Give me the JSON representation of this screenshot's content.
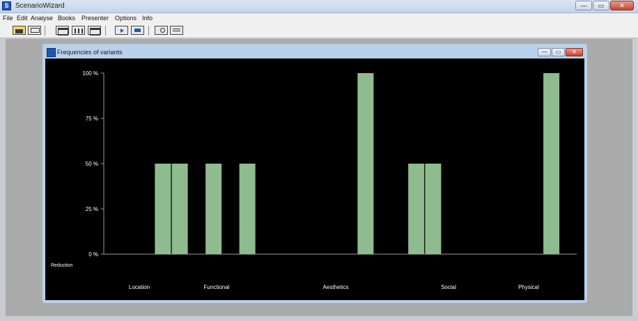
{
  "app": {
    "title": "ScenarioWizard",
    "menu": [
      "File",
      "Edit",
      "Analyse",
      "Books",
      "Presenter",
      "Options",
      "Info"
    ],
    "window_buttons": {
      "minimize": "—",
      "maximize": "▭",
      "close": "✕"
    }
  },
  "toolbar": {
    "buttons": [
      "open-icon",
      "save-icon",
      "table-icon",
      "columns-icon",
      "grid-icon",
      "play-icon",
      "text-icon",
      "search-icon",
      "list-icon"
    ]
  },
  "chart_window": {
    "title": "Frequencies of variants",
    "buttons": {
      "minimize": "—",
      "maximize": "▭",
      "close": "✕"
    }
  },
  "chart_data": {
    "type": "bar",
    "ylim": [
      0,
      100
    ],
    "yticks": [
      "0 %",
      "25 %",
      "50 %",
      "75 %",
      "100 %"
    ],
    "bar_color": "#8fbc8f",
    "background": "#000000",
    "values": [
      0,
      0,
      0,
      50,
      50,
      0,
      50,
      0,
      50,
      0,
      0,
      0,
      0,
      0,
      0,
      100,
      0,
      0,
      50,
      50,
      0,
      0,
      0,
      0,
      0,
      0,
      100,
      0
    ],
    "category_tick_labels_first": "Reduction",
    "groups": [
      "Location",
      "Functional",
      "Aesthetics",
      "Social",
      "Physical"
    ]
  }
}
